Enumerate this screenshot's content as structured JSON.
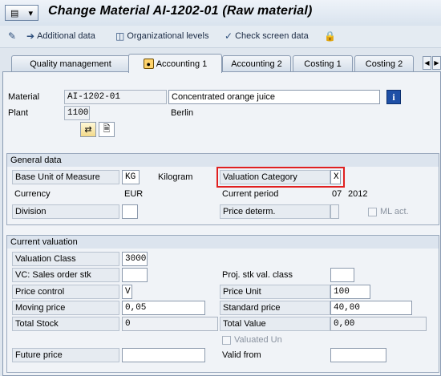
{
  "title": "Change Material AI-1202-01 (Raw material)",
  "toolbar": {
    "additional_data": "Additional data",
    "org_levels": "Organizational levels",
    "check_screen": "Check screen data"
  },
  "tabs": [
    "Quality management",
    "Accounting 1",
    "Accounting 2",
    "Costing 1",
    "Costing 2"
  ],
  "active_tab": "Accounting 1",
  "header": {
    "material_label": "Material",
    "material_value": "AI-1202-01",
    "material_desc": "Concentrated orange juice",
    "plant_label": "Plant",
    "plant_value": "1100",
    "plant_name": "Berlin"
  },
  "general_data": {
    "title": "General data",
    "base_uom_label": "Base Unit of Measure",
    "base_uom_value": "KG",
    "base_uom_text": "Kilogram",
    "valuation_category_label": "Valuation Category",
    "valuation_category_value": "X",
    "currency_label": "Currency",
    "currency_value": "EUR",
    "current_period_label": "Current period",
    "current_period_month": "07",
    "current_period_year": "2012",
    "division_label": "Division",
    "division_value": "",
    "price_determ_label": "Price determ.",
    "ml_act_label": "ML act."
  },
  "current_valuation": {
    "title": "Current valuation",
    "valuation_class_label": "Valuation Class",
    "valuation_class_value": "3000",
    "vc_sales_order_label": "VC: Sales order stk",
    "vc_sales_order_value": "",
    "proj_stk_label": "Proj. stk val. class",
    "proj_stk_value": "",
    "price_control_label": "Price control",
    "price_control_value": "V",
    "price_unit_label": "Price Unit",
    "price_unit_value": "100",
    "moving_price_label": "Moving price",
    "moving_price_value": "0,05",
    "standard_price_label": "Standard price",
    "standard_price_value": "40,00",
    "total_stock_label": "Total Stock",
    "total_stock_value": "0",
    "total_value_label": "Total Value",
    "total_value_value": "0,00",
    "valuated_un_label": "Valuated Un",
    "future_price_label": "Future price",
    "future_price_value": "",
    "valid_from_label": "Valid from",
    "valid_from_value": ""
  },
  "colors": {
    "highlight": "#e02020",
    "info_button": "#1e4fa6"
  }
}
